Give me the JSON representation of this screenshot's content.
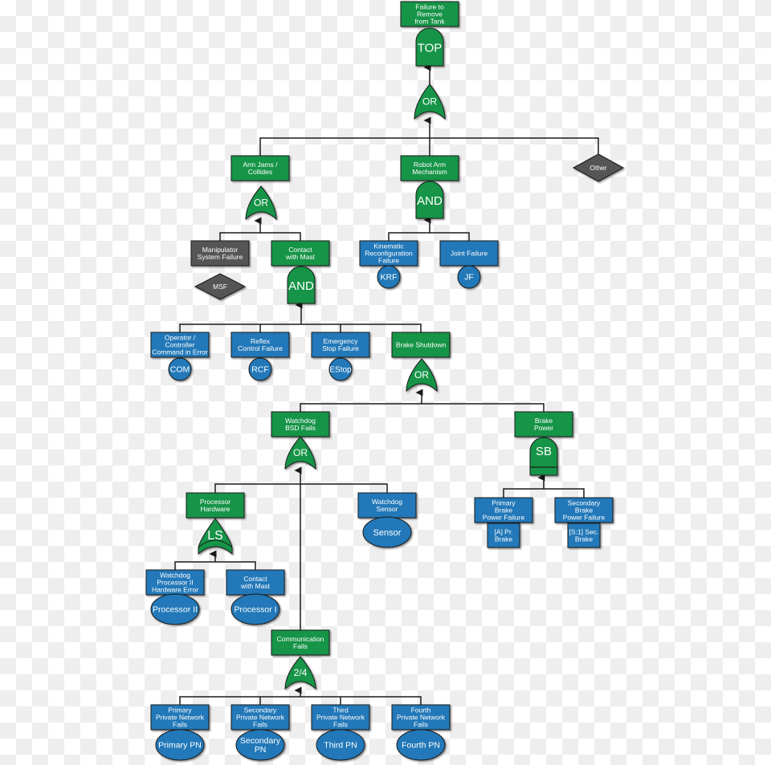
{
  "colors": {
    "intermediate": "#129447",
    "basic": "#2178b8",
    "undeveloped": "#555555",
    "line": "#1a1a1a"
  },
  "events": {
    "top": [
      "Failure to",
      "Remove",
      "from Tank"
    ],
    "arm_jams": [
      "Arm Jams /",
      "Collides"
    ],
    "robot_arm": [
      "Robot Arm",
      "Mechanism"
    ],
    "other": [
      "Other"
    ],
    "manipulator": [
      "Manipulator",
      "System Failure"
    ],
    "msf": [
      "MSF"
    ],
    "contact_mast": [
      "Contact",
      "with Mast"
    ],
    "kinematic": [
      "Kinematic",
      "Reconfiguration",
      "Failure"
    ],
    "joint": [
      "Joint Failure"
    ],
    "operator": [
      "Operator /",
      "Controller",
      "Command in Error"
    ],
    "reflex": [
      "Reflex",
      "Control Failure"
    ],
    "estop_fail": [
      "Emergency",
      "Stop Failure"
    ],
    "brake_shutdown": [
      "Brake Shutdown"
    ],
    "watchdog_bsd": [
      "Watchdog",
      "BSD Fails"
    ],
    "brake_power": [
      "Brake",
      "Power"
    ],
    "processor_hw": [
      "Processor",
      "Hardware"
    ],
    "watchdog_sensor": [
      "Watchdog",
      "Sensor"
    ],
    "primary_brake": [
      "Primary",
      "Brake",
      "Power Failure"
    ],
    "secondary_brake": [
      "Secondary",
      "Brake",
      "Power Failure"
    ],
    "a_pr_brake": [
      "[A] Pr.",
      "Brake"
    ],
    "s1_sec_brake": [
      "[S:1] Sec.",
      "Brake"
    ],
    "wd_proc2": [
      "Watchdog",
      "Processor II",
      "Hardware Error"
    ],
    "contact_mast2": [
      "Contact",
      "with Mast"
    ],
    "comm_fails": [
      "Communication",
      "Fails"
    ],
    "ppn_fail": [
      "Primary",
      "Private Network",
      "Fails"
    ],
    "spn_fail": [
      "Secondary",
      "Private Network",
      "Fails"
    ],
    "tpn_fail": [
      "Third",
      "Private Network",
      "Fails"
    ],
    "fpn_fail": [
      "Fourth",
      "Private Network",
      "Fails"
    ]
  },
  "basic_events": {
    "krf": [
      "KRF"
    ],
    "jf": [
      "JF"
    ],
    "com": [
      "COM"
    ],
    "rcf": [
      "RCF"
    ],
    "estop": [
      "EStop"
    ],
    "sensor": [
      "Sensor"
    ],
    "proc2": [
      "Processor II"
    ],
    "proc1": [
      "Processor I"
    ],
    "ppn": [
      "Primary PN"
    ],
    "spn": [
      "Secondary",
      "PN"
    ],
    "tpn": [
      "Third PN"
    ],
    "fpn": [
      "Fourth PN"
    ]
  },
  "gates": {
    "g_top": "TOP",
    "g_or1": "OR",
    "g_or2": "OR",
    "g_and1": "AND",
    "g_and2": "AND",
    "g_or3": "OR",
    "g_or4": "OR",
    "g_sb": "SB",
    "g_ls": "LS",
    "g_24": "2/4"
  }
}
